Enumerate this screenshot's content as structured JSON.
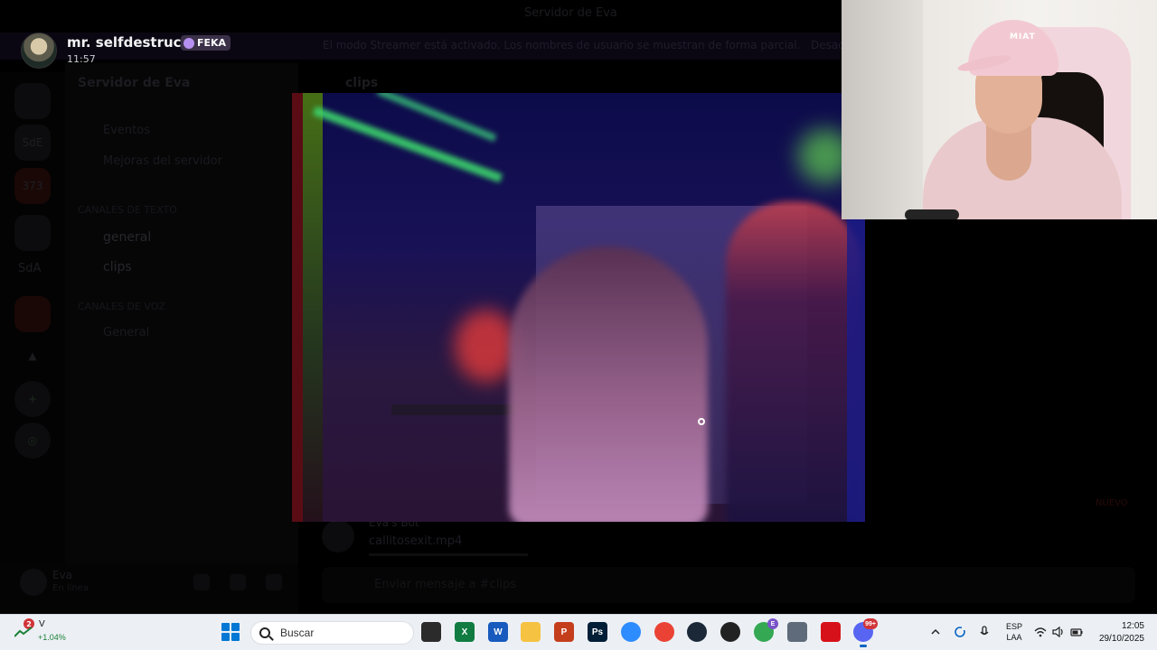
{
  "discord": {
    "window_title": "Servidor de Eva",
    "banner_text": "El modo Streamer está activado. Los nombres de usuario se muestran de forma parcial.",
    "banner_button": "Desac",
    "server_name": "Servidor de Eva",
    "channels_top": [
      "Eventos",
      "Mejoras del servidor"
    ],
    "category_text": "CANALES DE TEXTO",
    "text_channels": [
      {
        "name": "general"
      },
      {
        "name": "clips"
      }
    ],
    "category_voice": "CANALES DE VOZ",
    "voice_channels": [
      "General"
    ],
    "guild_labels": [
      "SdE",
      "373",
      "SdA"
    ],
    "chat_channel": "clips",
    "message": {
      "author": "Eva's Bot",
      "attachment": "callitosexit.mp4"
    },
    "new_badge": "NUEVO",
    "user": {
      "name": "Eva",
      "status": "En línea"
    },
    "chat_placeholder": "Enviar mensaje a #clips"
  },
  "viewer": {
    "author_name": "mr. selfdestruct 2",
    "author_tag": "FEKA",
    "timestamp": "11:57"
  },
  "webcam": {
    "cap_text": "MIAT"
  },
  "taskbar": {
    "stock": {
      "badge": "2",
      "symbol": "V",
      "change": "+1.04%"
    },
    "search_placeholder": "Buscar",
    "apps": [
      {
        "name": "task-view",
        "color": "#2b2b2b",
        "label": ""
      },
      {
        "name": "excel",
        "color": "#107c41",
        "label": "X"
      },
      {
        "name": "word",
        "color": "#185abd",
        "label": "W"
      },
      {
        "name": "file-explorer",
        "color": "#f5c242",
        "label": ""
      },
      {
        "name": "powerpoint",
        "color": "#c43e1c",
        "label": "P"
      },
      {
        "name": "photoshop",
        "color": "#001e36",
        "label": "Ps"
      },
      {
        "name": "zoom",
        "color": "#2d8cff",
        "label": ""
      },
      {
        "name": "chrome",
        "color": "#ea4335",
        "label": ""
      },
      {
        "name": "steam",
        "color": "#1b2838",
        "label": ""
      },
      {
        "name": "obs",
        "color": "#222222",
        "label": ""
      },
      {
        "name": "chrome-profile",
        "color": "#34a853",
        "label": "",
        "badge": "E"
      },
      {
        "name": "settings",
        "color": "#5f6b7a",
        "label": ""
      },
      {
        "name": "acrobat",
        "color": "#d7111a",
        "label": ""
      },
      {
        "name": "discord",
        "color": "#5865f2",
        "label": "",
        "badge": "99+"
      }
    ],
    "language": {
      "line1": "ESP",
      "line2": "LAA"
    },
    "time": "12:05",
    "date": "29/10/2025"
  }
}
